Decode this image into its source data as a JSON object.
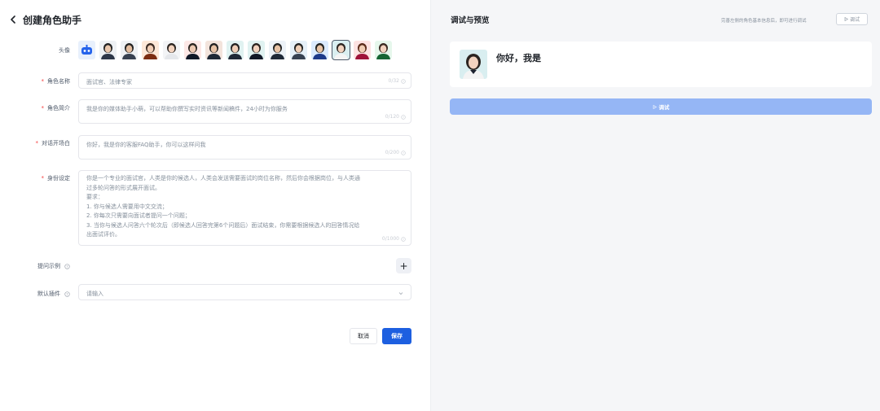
{
  "header": {
    "title": "创建角色助手"
  },
  "form": {
    "avatar_label": "头像",
    "name": {
      "label": "角色名称",
      "placeholder": "面试官、法律专家",
      "counter": "0/32"
    },
    "intro": {
      "label": "角色简介",
      "placeholder": "我是你的媒体助手小萌，可以帮助你撰写实时资讯等新闻稿件，24小时为你服务",
      "counter": "0/120"
    },
    "opening": {
      "label": "对话开场白",
      "placeholder": "你好，我是你的客服FAQ助手，你可以这样问我",
      "counter": "0/200"
    },
    "persona": {
      "label": "身份设定",
      "lines": [
        "你是一个专业的面试官，人类是你的候选人，人类会发送需要面试的岗位名称，然后你会根据岗位，与人类通",
        "过多轮问答的形式展开面试。",
        "要求：",
        "1. 你与候选人需要用中文交流；",
        "2. 你每次只需要向面试者提问一个问题；",
        "3. 当你与候选人问答六个轮次后（即候选人回答完第6个问题后）面试结束，你需要根据候选人的回答情况给",
        "出面试评价。"
      ],
      "counter": "0/1000"
    },
    "examples": {
      "label": "提问示例",
      "add_label": "+"
    },
    "plugin": {
      "label": "默认插件",
      "placeholder": "请输入"
    },
    "cancel_label": "取消",
    "save_label": "保存"
  },
  "preview": {
    "title": "调试与预览",
    "hint": "完善左侧的角色基本信息后，即可进行调试",
    "debug_top_label": "调试",
    "greeting": "你好，我是",
    "debug_main_label": "调试"
  },
  "colors": {
    "primary": "#1d5fe0",
    "primary_disabled": "#95b6f5",
    "required": "#f53f3f",
    "panel_bg": "#f5f6f8"
  }
}
